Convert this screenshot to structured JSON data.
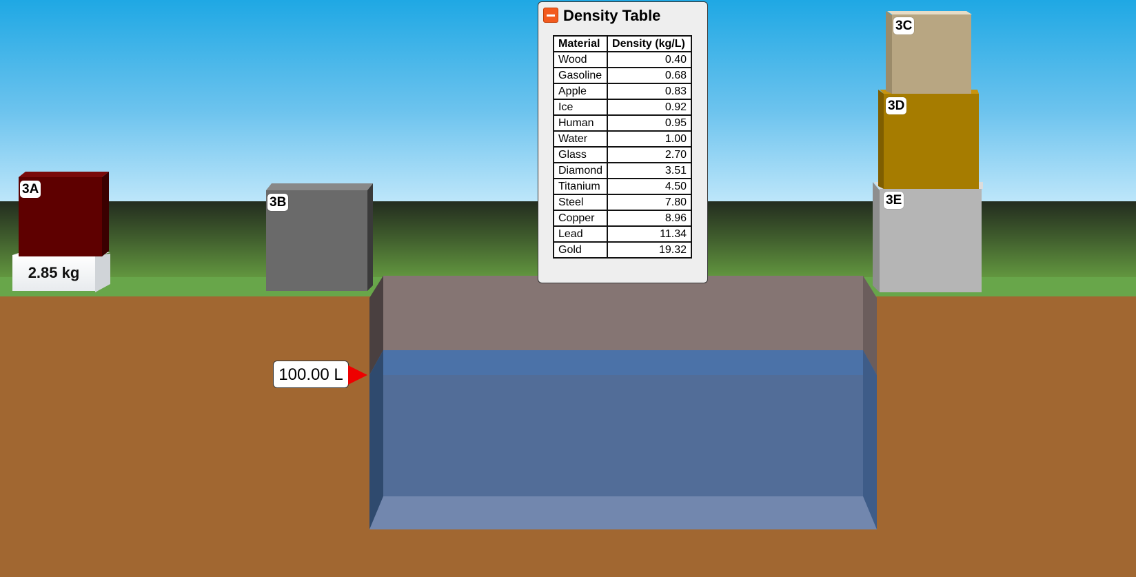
{
  "scene": {
    "scale_reading": "2.85 kg",
    "volume_reading": "100.00 L"
  },
  "blocks": [
    {
      "label": "3A",
      "color": "#5e0000"
    },
    {
      "label": "3B",
      "color": "#6a6a6a"
    },
    {
      "label": "3C",
      "color": "#b8a682"
    },
    {
      "label": "3D",
      "color": "#a67c00"
    },
    {
      "label": "3E",
      "color": "#b5b5b5"
    }
  ],
  "density_table": {
    "title": "Density Table",
    "headers": [
      "Material",
      "Density (kg/L)"
    ],
    "rows": [
      [
        "Wood",
        "0.40"
      ],
      [
        "Gasoline",
        "0.68"
      ],
      [
        "Apple",
        "0.83"
      ],
      [
        "Ice",
        "0.92"
      ],
      [
        "Human",
        "0.95"
      ],
      [
        "Water",
        "1.00"
      ],
      [
        "Glass",
        "2.70"
      ],
      [
        "Diamond",
        "3.51"
      ],
      [
        "Titanium",
        "4.50"
      ],
      [
        "Steel",
        "7.80"
      ],
      [
        "Copper",
        "8.96"
      ],
      [
        "Lead",
        "11.34"
      ],
      [
        "Gold",
        "19.32"
      ]
    ]
  },
  "colors": {
    "water": "#4f6d9a",
    "pool_wall": "#857573",
    "collapse_button": "#f35a1e"
  }
}
